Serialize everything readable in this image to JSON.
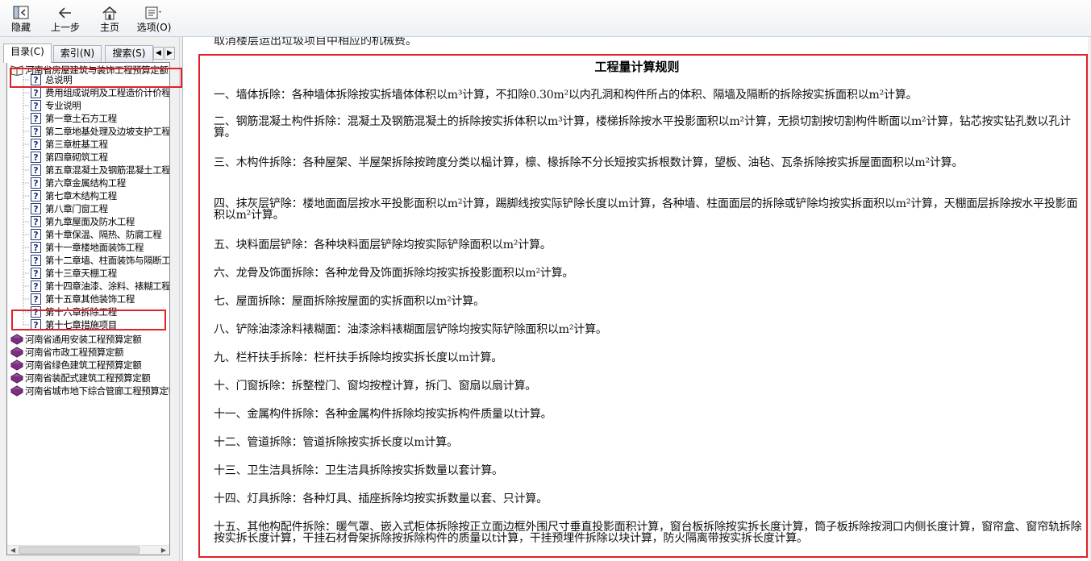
{
  "toolbar": {
    "buttons": [
      {
        "label": "隐藏",
        "icon": "hide-icon"
      },
      {
        "label": "上一步",
        "icon": "back-arrow-icon"
      },
      {
        "label": "主页",
        "icon": "home-icon"
      },
      {
        "label": "选项(O)",
        "icon": "options-icon"
      }
    ]
  },
  "tabs": [
    {
      "label": "目录(C)",
      "active": true
    },
    {
      "label": "索引(N)",
      "active": false
    },
    {
      "label": "搜索(S)",
      "active": false
    }
  ],
  "tree": {
    "root": "河南省房屋建筑与装饰工程预算定额",
    "pages": [
      "总说明",
      "费用组成说明及工程造价计价程序",
      "专业说明",
      "第一章土石方工程",
      "第二章地基处理及边坡支护工程",
      "第三章桩基工程",
      "第四章砌筑工程",
      "第五章混凝土及钢筋混凝土工程",
      "第六章金属结构工程",
      "第七章木结构工程",
      "第八章门窗工程",
      "第九章屋面及防水工程",
      "第十章保温、隔热、防腐工程",
      "第十一章楼地面装饰工程",
      "第十二章墙、柱面装饰与隔断工程",
      "第十三章天棚工程",
      "第十四章油漆、涂料、裱糊工程",
      "第十五章其他装饰工程",
      "第十六章拆除工程",
      "第十七章措施项目"
    ],
    "books": [
      "河南省通用安装工程预算定额",
      "河南省市政工程预算定额",
      "河南省绿色建筑工程预算定额",
      "河南省装配式建筑工程预算定额",
      "河南省城市地下综合管廊工程预算定额"
    ]
  },
  "content": {
    "cut_line": "取消楼层运出垃圾项目中相应的机械费。",
    "title": "工程量计算规则",
    "paragraphs": [
      "一、墙体拆除：各种墙体拆除按实拆墙体体积以m³计算，不扣除0.30m²以内孔洞和构件所占的体积、隔墙及隔断的拆除按实拆面积以m²计算。",
      "二、钢筋混凝土构件拆除：混凝土及钢筋混凝土的拆除按实拆体积以m³计算，楼梯拆除按水平投影面积以m²计算，无损切割按切割构件断面以m²计算，钻芯按实钻孔数以孔计算。",
      "三、木构件拆除：各种屋架、半屋架拆除按跨度分类以榀计算，檩、椽拆除不分长短按实拆根数计算，望板、油毡、瓦条拆除按实拆屋面面积以m²计算。",
      "四、抹灰层铲除：楼地面面层按水平投影面积以m²计算，踢脚线按实际铲除长度以m计算，各种墙、柱面面层的拆除或铲除均按实拆面积以m²计算，天棚面层拆除按水平投影面积以m²计算。",
      "五、块料面层铲除：各种块料面层铲除均按实际铲除面积以m²计算。",
      "六、龙骨及饰面拆除：各种龙骨及饰面拆除均按实拆投影面积以m²计算。",
      "七、屋面拆除：屋面拆除按屋面的实拆面积以m²计算。",
      "八、铲除油漆涂料裱糊面：油漆涂料裱糊面层铲除均按实际铲除面积以m²计算。",
      "九、栏杆扶手拆除：栏杆扶手拆除均按实拆长度以m计算。",
      "十、门窗拆除：拆整樘门、窗均按樘计算，拆门、窗扇以扇计算。",
      "十一、金属构件拆除：各种金属构件拆除均按实拆构件质量以t计算。",
      "十二、管道拆除：管道拆除按实拆长度以m计算。",
      "十三、卫生洁具拆除：卫生洁具拆除按实拆数量以套计算。",
      "十四、灯具拆除：各种灯具、插座拆除均按实拆数量以套、只计算。",
      "十五、其他构配件拆除：暖气罩、嵌入式柜体拆除按正立面边框外围尺寸垂直投影面积计算，窗台板拆除按实拆长度计算，筒子板拆除按洞口内侧长度计算，窗帘盒、窗帘轨拆除按实拆长度计算，干挂石材骨架拆除按拆除构件的质量以t计算，干挂预埋件拆除以块计算，防火隔离带按实拆长度计算。"
    ]
  },
  "colors": {
    "highlight_box": "#e0202a",
    "book_icon": "#7b2f7f"
  }
}
